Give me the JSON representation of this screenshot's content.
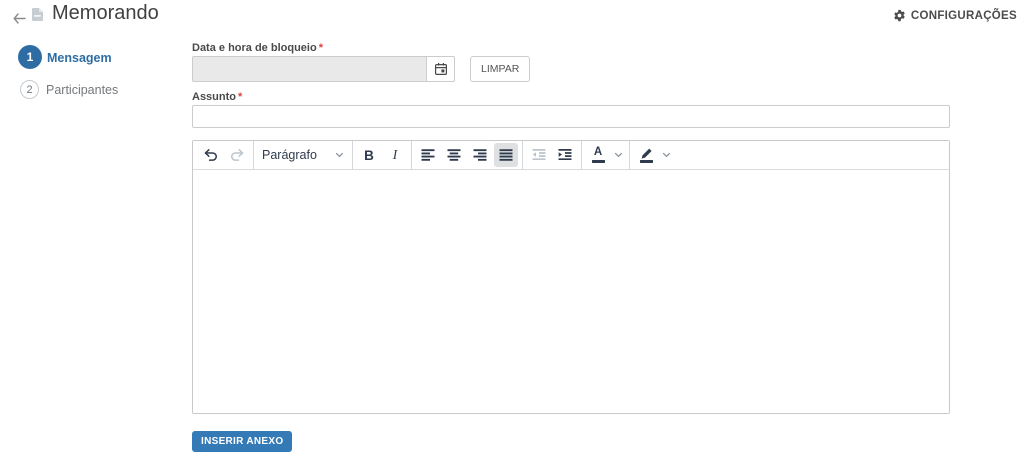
{
  "header": {
    "title": "Memorando",
    "settings_label": "CONFIGURAÇÕES"
  },
  "stepper": {
    "steps": [
      {
        "number": "1",
        "label": "Mensagem",
        "active": true
      },
      {
        "number": "2",
        "label": "Participantes",
        "active": false
      }
    ]
  },
  "form": {
    "block_date": {
      "label": "Data e hora de bloqueio",
      "required": "*",
      "value": "",
      "disabled": true,
      "clear_label": "LIMPAR"
    },
    "subject": {
      "label": "Assunto",
      "required": "*",
      "value": "",
      "placeholder": ""
    },
    "attach_label": "INSERIR ANEXO"
  },
  "editor": {
    "paragraph_label": "Parágrafo",
    "bold_label": "B",
    "italic_label": "I",
    "content": "",
    "toolbar_state": {
      "undo": "enabled",
      "redo": "disabled",
      "justify": "active",
      "outdent": "disabled"
    }
  },
  "icons": {
    "back": "arrow-left",
    "document": "file",
    "settings": "gear",
    "calendar": "calendar",
    "editor_toolbar": [
      "undo",
      "redo",
      "paragraph-dropdown",
      "bold",
      "italic",
      "align-left",
      "align-center",
      "align-right",
      "justify",
      "outdent",
      "indent",
      "text-color",
      "highlight-color"
    ]
  },
  "colors": {
    "accent_blue": "#2e6da4",
    "primary_button_blue": "#337ab7",
    "required_red": "#dd4040",
    "toolbar_icon": "#2f3b4d",
    "disabled_input_bg": "#e9e9e9"
  }
}
